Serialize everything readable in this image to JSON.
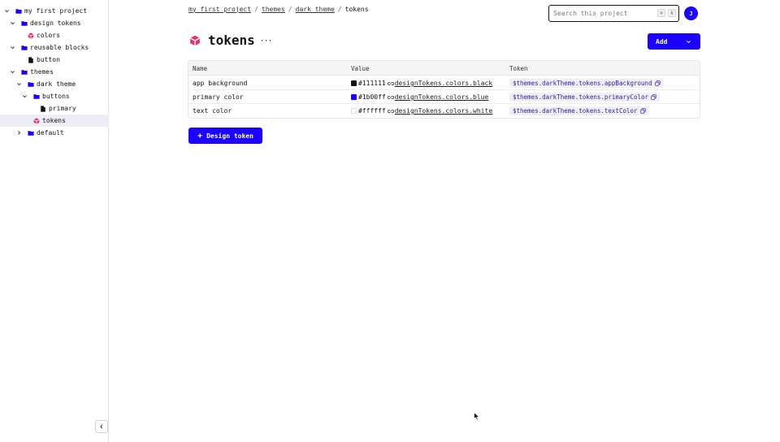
{
  "sidebar": {
    "items": [
      {
        "label": "my first project",
        "icon": "folder-icon",
        "expanded": true
      },
      {
        "label": "design tokens",
        "icon": "folder-icon",
        "expanded": true
      },
      {
        "label": "colors",
        "icon": "token-set-icon"
      },
      {
        "label": "reusable blocks",
        "icon": "folder-icon",
        "expanded": true
      },
      {
        "label": "button",
        "icon": "file-icon"
      },
      {
        "label": "themes",
        "icon": "folder-icon",
        "expanded": true
      },
      {
        "label": "dark theme",
        "icon": "folder-icon",
        "expanded": true
      },
      {
        "label": "buttons",
        "icon": "folder-icon",
        "expanded": true
      },
      {
        "label": "primary",
        "icon": "file-icon"
      },
      {
        "label": "tokens",
        "icon": "token-set-icon",
        "selected": true
      },
      {
        "label": "default",
        "icon": "folder-icon",
        "expanded": false
      }
    ],
    "collapse_icon": "chevron-left-icon"
  },
  "breadcrumb": {
    "items": [
      "my first project",
      "themes",
      "dark theme"
    ],
    "current": "tokens",
    "separator": "/"
  },
  "search": {
    "placeholder": "Search this project",
    "shortcut_keys": [
      "⌘",
      "k"
    ]
  },
  "user": {
    "avatar_initial": "J"
  },
  "page": {
    "title": "tokens",
    "more_label": "···",
    "add_label": "Add"
  },
  "table": {
    "columns": [
      "Name",
      "Value",
      "Token"
    ],
    "rows": [
      {
        "name": "app background",
        "color": "#111111",
        "hex": "#111111",
        "reference": "designTokens.colors.black",
        "token": "$themes.darkTheme.tokens.appBackground"
      },
      {
        "name": "primary color",
        "color": "#1b00ff",
        "hex": "#1b00ff",
        "reference": "designTokens.colors.blue",
        "token": "$themes.darkTheme.tokens.primaryColor"
      },
      {
        "name": "text color",
        "color": "#ffffff",
        "hex": "#ffffff",
        "reference": "designTokens.colors.white",
        "token": "$themes.darkTheme.tokens.textColor"
      }
    ]
  },
  "actions": {
    "add_design_token_label": "Design token",
    "add_design_token_icon": "plus-icon"
  },
  "colors": {
    "accent": "#1b00ff",
    "token_icon": "#e5307a",
    "folder": "#1b00ff"
  }
}
